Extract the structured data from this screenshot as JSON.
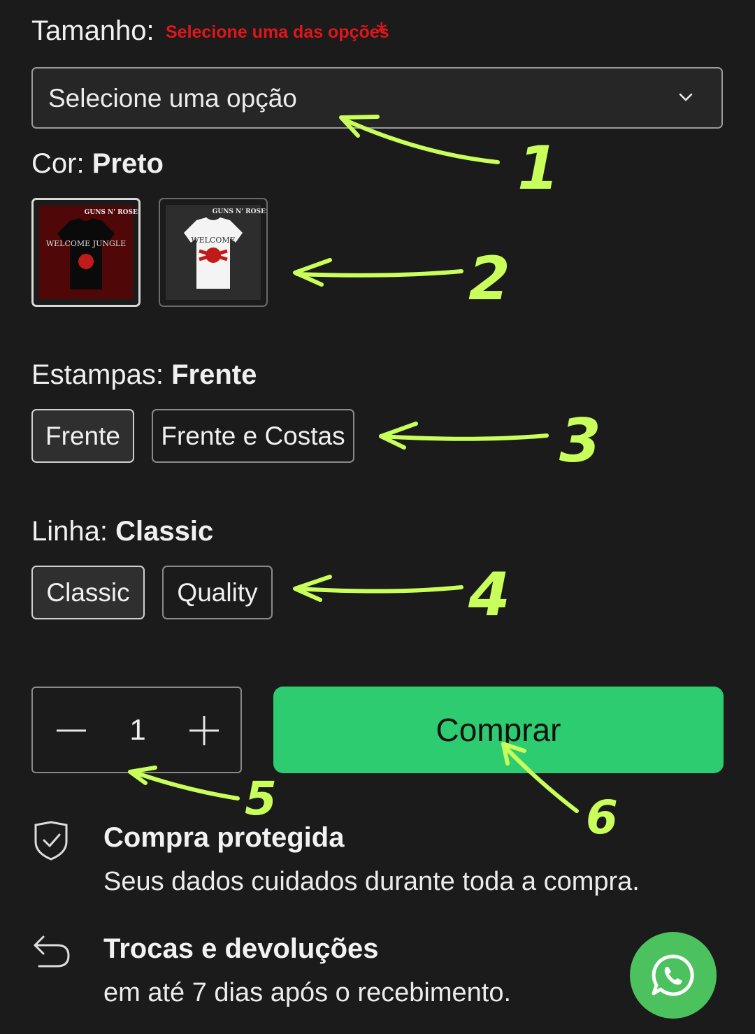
{
  "size": {
    "label": "Tamanho:",
    "required_message": "Selecione uma das opções",
    "required_mark": "*",
    "select_value": "Selecione uma opção"
  },
  "color": {
    "label": "Cor:",
    "selected": "Preto",
    "swatches": [
      {
        "name": "black-tshirt",
        "shirt_color": "#0a0a0a",
        "bg": "#7a0c0c",
        "brand": "GUNS N' ROSES",
        "print": "WELCOME JUNGLE"
      },
      {
        "name": "white-tshirt",
        "shirt_color": "#f4f4f4",
        "bg": "#3a3a3a",
        "brand": "GUNS N' ROSES",
        "print": "WELCOME"
      }
    ]
  },
  "print": {
    "label": "Estampas:",
    "selected": "Frente",
    "options": [
      "Frente",
      "Frente e Costas"
    ]
  },
  "line": {
    "label": "Linha:",
    "selected": "Classic",
    "options": [
      "Classic",
      "Quality"
    ]
  },
  "quantity": {
    "value": "1",
    "minus_icon": "minus-icon",
    "plus_icon": "plus-icon"
  },
  "buy_button": {
    "label": "Comprar",
    "color": "#2ecc71"
  },
  "info": [
    {
      "icon": "shield-check-icon",
      "title": "Compra protegida",
      "text": "Seus dados cuidados durante toda a compra."
    },
    {
      "icon": "return-arrow-icon",
      "title": "Trocas e devoluções",
      "text": "em até 7 dias após o recebimento."
    }
  ],
  "whatsapp": {
    "icon": "whatsapp-icon",
    "color": "#4cc25f"
  },
  "annotations": {
    "color": "#c9ff5a",
    "numbers": [
      "1",
      "2",
      "3",
      "4",
      "5",
      "6"
    ]
  }
}
